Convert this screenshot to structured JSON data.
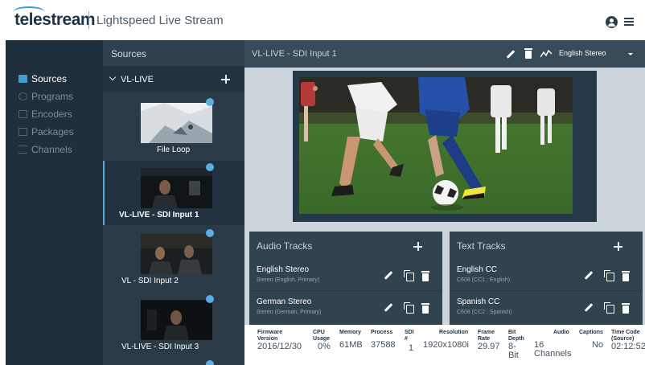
{
  "header": {
    "brand": "telestream",
    "app_title": "Lightspeed Live Stream",
    "user_icon": "user-circle-icon",
    "menu_icon": "hamburger-menu-icon"
  },
  "nav": {
    "items": [
      {
        "label": "Sources",
        "icon": "sources-icon"
      },
      {
        "label": "Programs",
        "icon": "programs-icon"
      },
      {
        "label": "Encoders",
        "icon": "encoders-icon"
      },
      {
        "label": "Packages",
        "icon": "packages-icon"
      },
      {
        "label": "Channels",
        "icon": "channels-icon"
      }
    ],
    "active": "Sources"
  },
  "sources": {
    "title": "Sources",
    "group": "VL-LIVE",
    "items": [
      {
        "label": "File Loop"
      },
      {
        "label": "VL-LIVE - SDI Input 1"
      },
      {
        "label": "VL - SDI Input 2"
      },
      {
        "label": "VL-LIVE - SDI Input 3"
      }
    ]
  },
  "main": {
    "title": "VL-LIVE - SDI Input 1",
    "audio_select": "English Stereo"
  },
  "audio_tracks": {
    "title": "Audio Tracks",
    "items": [
      {
        "name": "English Stereo",
        "detail": "Stereo (English, Primary)"
      },
      {
        "name": "German Stereo",
        "detail": "Stereo (German, Primary)"
      }
    ]
  },
  "text_tracks": {
    "title": "Text Tracks",
    "items": [
      {
        "name": "English CC",
        "detail": "C608 (CC1 : English)"
      },
      {
        "name": "Spanish CC",
        "detail": "C608 (CC2 : Spanish)"
      }
    ]
  },
  "status": {
    "firmware": {
      "h1": "Firmware",
      "h2": "Version",
      "value": "2016/12/30"
    },
    "cpu": {
      "h1": "CPU",
      "h2": "Usage",
      "value": "0%"
    },
    "memory": {
      "h1": "Memory",
      "value": "61MB"
    },
    "process": {
      "h1": "Process",
      "value": "37588"
    },
    "sdi": {
      "h1": "SDI",
      "h2": "#",
      "value": "1"
    },
    "resolution": {
      "h1": "Resolution",
      "value": "1920x1080i"
    },
    "frame_rate": {
      "h1": "Frame",
      "h2": "Rate",
      "value": "29.97"
    },
    "bit_depth": {
      "h1": "Bit",
      "h2": "Depth",
      "value1": "8-",
      "value2": "Bit"
    },
    "audio": {
      "h1": "Audio",
      "value1": "16",
      "value2": "Channels"
    },
    "captions": {
      "h1": "Captions",
      "value": "No"
    },
    "time_code": {
      "h1": "Time Code",
      "h2": "(Source)",
      "value": "02:12:52"
    }
  },
  "colors": {
    "accent": "#4fa9e0",
    "nav_bg": "#1f2f3b",
    "panel_bg": "#31434f",
    "main_bg": "#ccd5dc"
  }
}
